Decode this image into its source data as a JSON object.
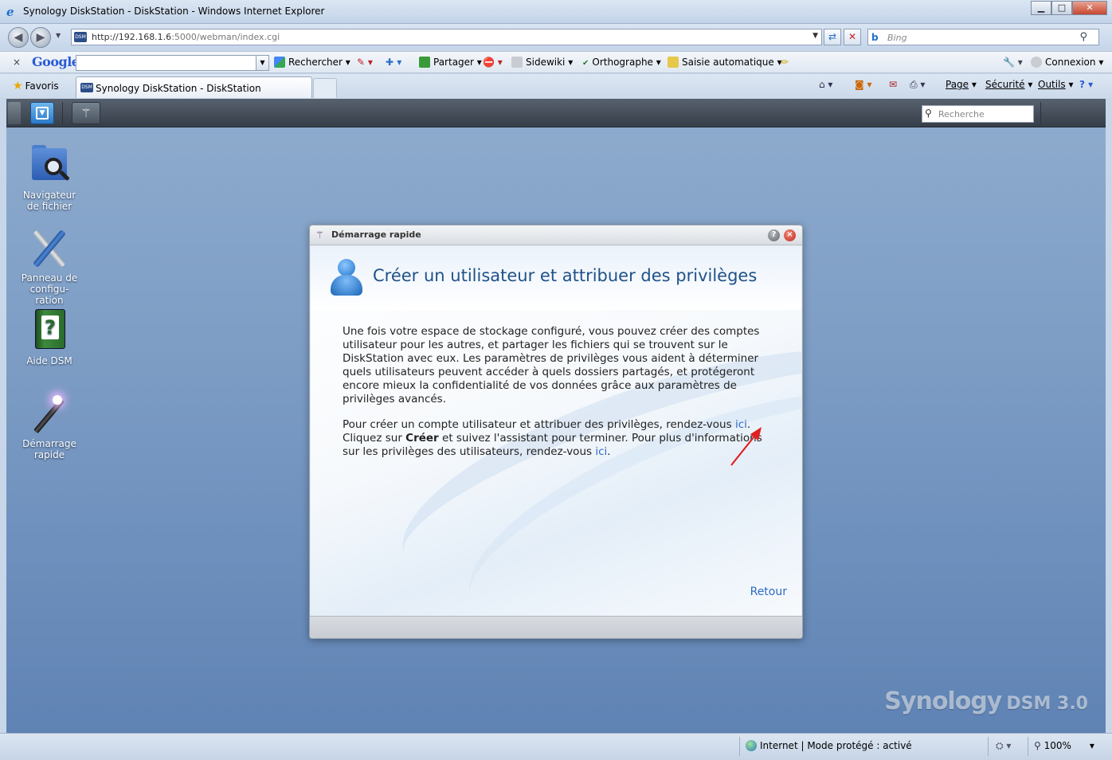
{
  "window": {
    "title": "Synology DiskStation - DiskStation - Windows Internet Explorer",
    "minimize": "▁",
    "maximize": "□",
    "close": "✕"
  },
  "navbar": {
    "url_host": "http://192.168.1.6",
    "url_path": ":5000/webman/index.cgi",
    "search_placeholder": "Bing"
  },
  "googlebar": {
    "close": "×",
    "logo": "Google",
    "rechercher": "Rechercher",
    "partager": "Partager",
    "sidewiki": "Sidewiki",
    "orthographe": "Orthographe",
    "saisie": "Saisie automatique",
    "connexion": "Connexion"
  },
  "tabbar": {
    "favoris": "Favoris",
    "tab_title": "Synology DiskStation - DiskStation",
    "page": "Page",
    "securite": "Sécurité",
    "outils": "Outils"
  },
  "dsm": {
    "search_placeholder": "Recherche",
    "icons": [
      {
        "label_line1": "Navigateur",
        "label_line2": "de fichier"
      },
      {
        "label_line1": "Panneau de",
        "label_line2": "configu-",
        "label_line3": "ration"
      },
      {
        "label_line1": "Aide DSM"
      },
      {
        "label_line1": "Démarrage",
        "label_line2": "rapide"
      }
    ],
    "brand": "Synology",
    "brand_version": "DSM 3.0"
  },
  "dialog": {
    "title": "Démarrage rapide",
    "heading": "Créer un utilisateur et attribuer des privilèges",
    "para1": "Une fois votre espace de stockage configuré, vous pouvez créer des comptes utilisateur pour les autres, et partager les fichiers qui se trouvent sur le DiskStation avec eux. Les paramètres de privilèges vous aident à déterminer quels utilisateurs peuvent accéder à quels dossiers partagés, et protégeront encore mieux la confidentialité de vos données grâce aux paramètres de privilèges avancés.",
    "para2_a": "Pour créer un compte utilisateur et attribuer des privilèges, rendez-vous ",
    "link1": "ici",
    "para2_b": ".",
    "para2_c": "Cliquez sur ",
    "para2_bold": "Créer",
    "para2_d": " et suivez l'assistant pour terminer. Pour plus d'informations sur les privilèges des utilisateurs, rendez-vous ",
    "link2": "ici",
    "para2_e": ".",
    "retour": "Retour"
  },
  "statusbar": {
    "zone": "Internet | Mode protégé : activé",
    "zoom": "100%"
  },
  "colors": {
    "desktop": "#7d9dc5",
    "accent_link": "#2e6bc4",
    "heading": "#1f5189"
  }
}
